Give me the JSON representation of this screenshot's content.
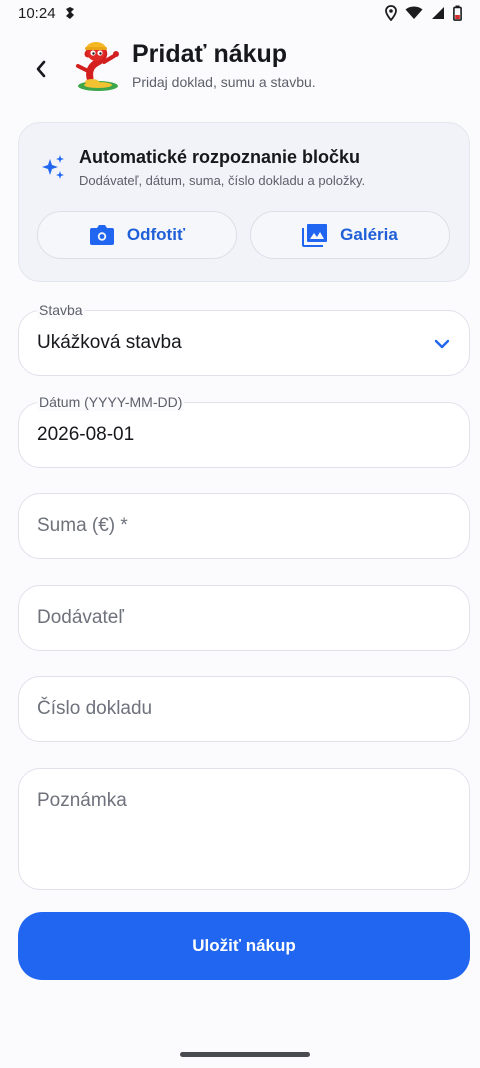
{
  "status_bar": {
    "time": "10:24",
    "icons": [
      "notification-icon",
      "location-icon",
      "wifi-icon",
      "signal-icon",
      "battery-icon"
    ]
  },
  "header": {
    "title": "Pridať nákup",
    "subtitle": "Pridaj doklad, sumu a stavbu."
  },
  "scan_card": {
    "title": "Automatické rozpoznanie bločku",
    "subtitle": "Dodávateľ, dátum, suma, číslo dokladu a položky.",
    "photo_label": "Odfotiť",
    "gallery_label": "Galéria"
  },
  "form": {
    "stavba": {
      "label": "Stavba",
      "value": "Ukážková stavba"
    },
    "datum": {
      "label": "Dátum (YYYY-MM-DD)",
      "value": "2026-08-01"
    },
    "suma": {
      "placeholder": "Suma (€) *"
    },
    "dodavatel": {
      "placeholder": "Dodávateľ"
    },
    "cislo": {
      "placeholder": "Číslo dokladu"
    },
    "poznamka": {
      "placeholder": "Poznámka"
    }
  },
  "save_label": "Uložiť nákup",
  "colors": {
    "accent": "#2166f0",
    "accent_text": "#1f5fd8",
    "background": "#fbfbfd",
    "card": "#f1f3f8"
  }
}
